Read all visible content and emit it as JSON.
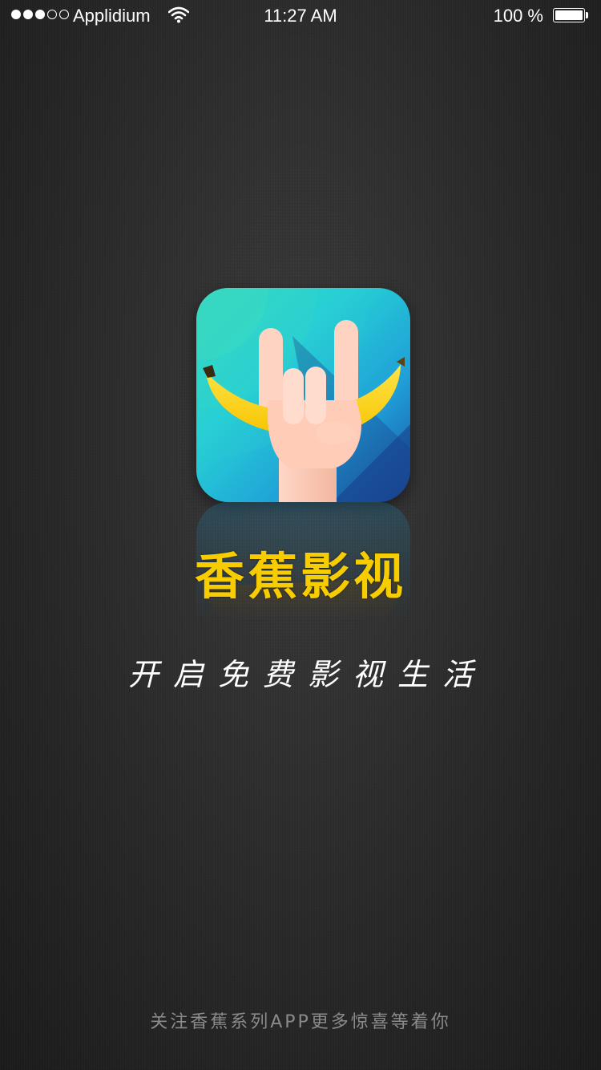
{
  "status_bar": {
    "signal_dots_filled": 3,
    "signal_dots_total": 5,
    "carrier": "Applidium",
    "wifi_icon": "wifi-icon",
    "time": "11:27 AM",
    "battery_text": "100 %",
    "battery_level": 1.0
  },
  "splash": {
    "app_icon": "banana-rock-hand-icon",
    "app_name": "香蕉影视",
    "slogan": "开启免费影视生活",
    "footer": "关注香蕉系列APP更多惊喜等着你"
  },
  "colors": {
    "background": "#1c1c1c",
    "app_name": "#f7cc00",
    "slogan": "#ffffff",
    "footer": "#8a8a8a",
    "icon_teal": "#2fd0c4",
    "icon_blue": "#1f5fa8",
    "banana_yellow": "#ffd800"
  }
}
